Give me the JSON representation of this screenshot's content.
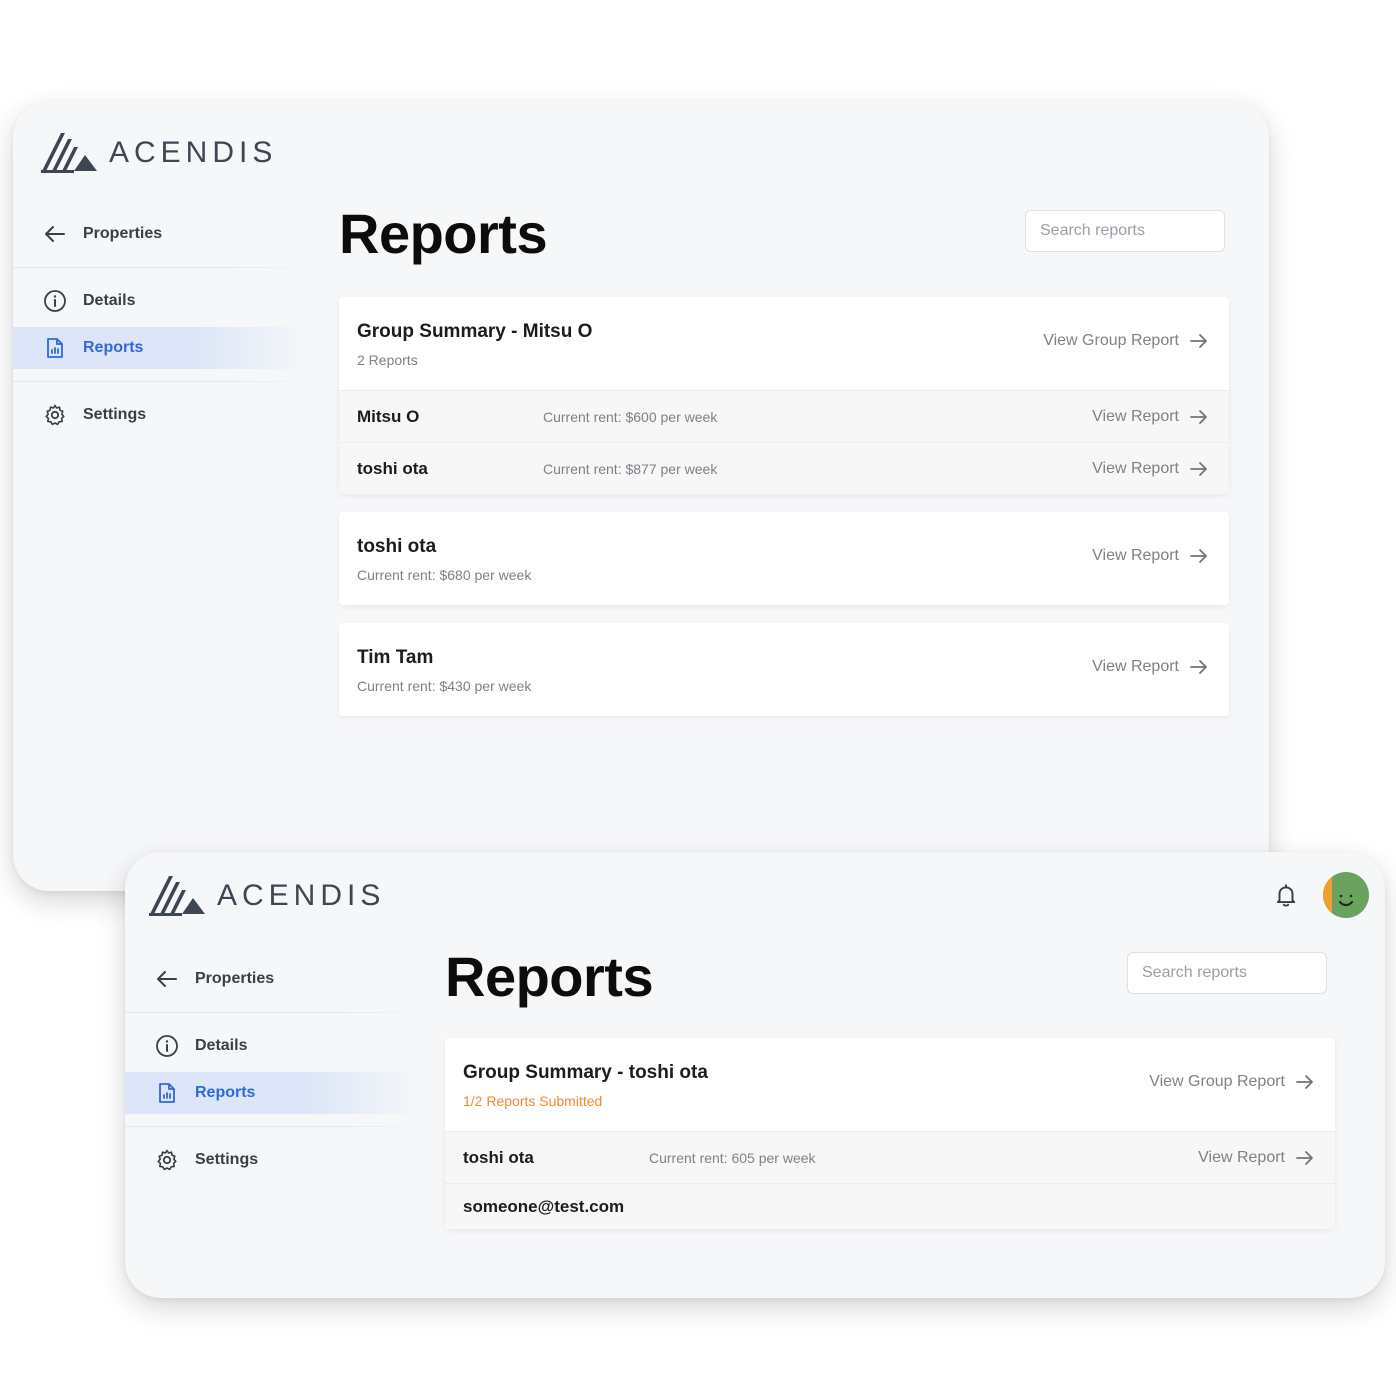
{
  "brand": {
    "name": "ACENDIS"
  },
  "window1": {
    "sidebar": {
      "back_label": "Properties",
      "items": [
        {
          "label": "Details",
          "icon": "info-icon",
          "active": false
        },
        {
          "label": "Reports",
          "icon": "report-icon",
          "active": true
        },
        {
          "label": "Settings",
          "icon": "gear-icon",
          "active": false
        }
      ]
    },
    "title": "Reports",
    "search": {
      "placeholder": "Search reports"
    },
    "group": {
      "title": "Group Summary - Mitsu O",
      "subtitle": "2 Reports",
      "link": "View Group Report",
      "rows": [
        {
          "name": "Mitsu O",
          "rent": "Current rent: $600 per week",
          "link": "View Report"
        },
        {
          "name": "toshi ota",
          "rent": "Current rent: $877 per week",
          "link": "View Report"
        }
      ]
    },
    "cards": [
      {
        "name": "toshi ota",
        "rent": "Current rent: $680 per week",
        "link": "View Report"
      },
      {
        "name": "Tim Tam",
        "rent": "Current rent: $430 per week",
        "link": "View Report"
      }
    ]
  },
  "window2": {
    "sidebar": {
      "back_label": "Properties",
      "items": [
        {
          "label": "Details",
          "icon": "info-icon",
          "active": false
        },
        {
          "label": "Reports",
          "icon": "report-icon",
          "active": true
        },
        {
          "label": "Settings",
          "icon": "gear-icon",
          "active": false
        }
      ]
    },
    "title": "Reports",
    "search": {
      "placeholder": "Search reports"
    },
    "header_icons": [
      "bell-icon",
      "avatar"
    ],
    "group": {
      "title": "Group Summary - toshi ota",
      "subtitle": "1/2 Reports Submitted",
      "link": "View Group Report",
      "rows": [
        {
          "name": "toshi ota",
          "rent": "Current rent: 605 per week",
          "link": "View Report"
        },
        {
          "name": "someone@test.com"
        }
      ]
    }
  },
  "colors": {
    "accent": "#2f6ad9",
    "active_bg": "#dce6f8",
    "warning": "#ee8a2c",
    "window_bg": "#f6f7f9",
    "avatar_green": "#6aa35e",
    "avatar_orange": "#f0a02c"
  }
}
